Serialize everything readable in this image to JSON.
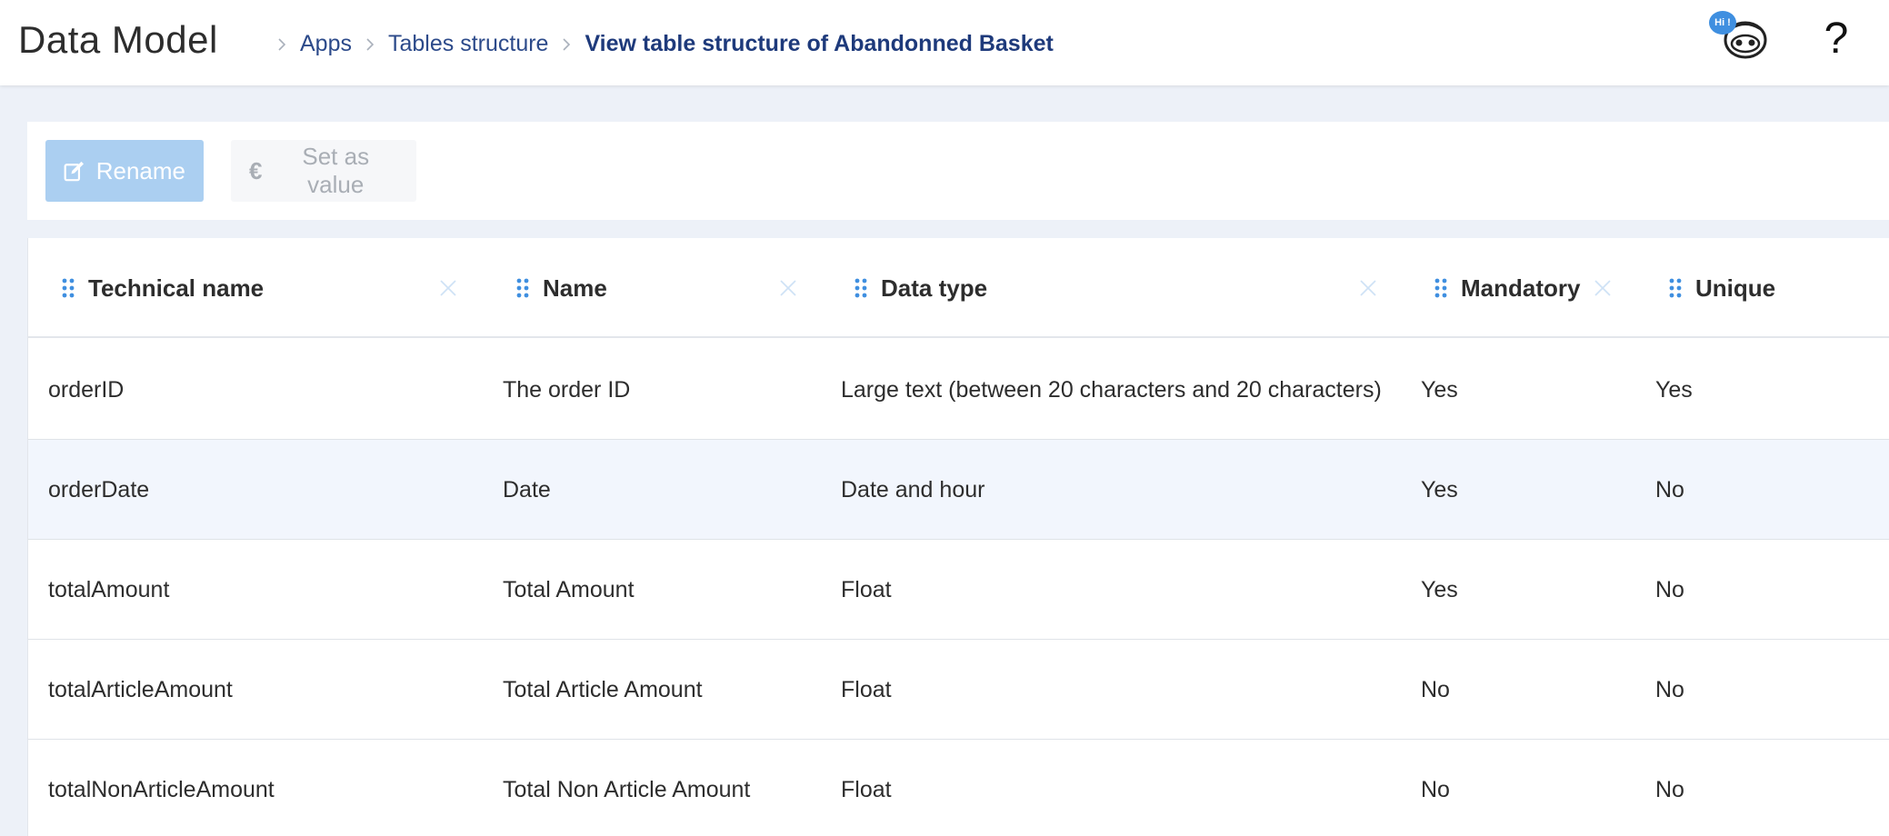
{
  "header": {
    "title": "Data Model",
    "breadcrumbs": [
      {
        "label": "Apps"
      },
      {
        "label": "Tables structure"
      },
      {
        "label": "View table structure of Abandonned Basket"
      }
    ],
    "bot_badge": "Hi !",
    "help_label": "?"
  },
  "toolbar": {
    "rename_label": "Rename",
    "rename_icon": "edit-icon",
    "set_value_label": "Set as value",
    "set_value_icon": "euro-icon"
  },
  "table": {
    "columns": [
      {
        "label": "Technical name"
      },
      {
        "label": "Name"
      },
      {
        "label": "Data type"
      },
      {
        "label": "Mandatory"
      },
      {
        "label": "Unique"
      }
    ],
    "rows": [
      {
        "technical_name": "orderID",
        "name": "The order ID",
        "data_type": "Large text (between 20 characters and 20 characters)",
        "mandatory": "Yes",
        "unique": "Yes"
      },
      {
        "technical_name": "orderDate",
        "name": "Date",
        "data_type": "Date and hour",
        "mandatory": "Yes",
        "unique": "No"
      },
      {
        "technical_name": "totalAmount",
        "name": "Total Amount",
        "data_type": "Float",
        "mandatory": "Yes",
        "unique": "No"
      },
      {
        "technical_name": "totalArticleAmount",
        "name": "Total Article Amount",
        "data_type": "Float",
        "mandatory": "No",
        "unique": "No"
      },
      {
        "technical_name": "totalNonArticleAmount",
        "name": "Total Non Article Amount",
        "data_type": "Float",
        "mandatory": "No",
        "unique": "No"
      }
    ]
  },
  "colors": {
    "accent": "#3f8fe0",
    "breadcrumb_link": "#2c4a8a",
    "rename_button": "#abcff1",
    "row_alt": "#f2f6fd"
  }
}
